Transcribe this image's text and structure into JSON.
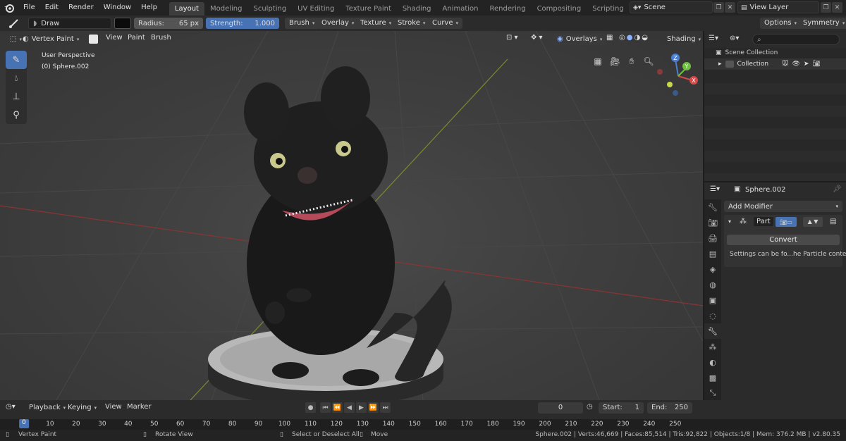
{
  "menu_bar": {
    "items": [
      "File",
      "Edit",
      "Render",
      "Window",
      "Help"
    ],
    "workspace_tabs": [
      "Layout",
      "Modeling",
      "Sculpting",
      "UV Editing",
      "Texture Paint",
      "Shading",
      "Animation",
      "Rendering",
      "Compositing",
      "Scripting"
    ],
    "active_tab": "Layout",
    "add_tab": "+",
    "scene": "Scene",
    "view_layer": "View Layer"
  },
  "tool_header": {
    "brush_name": "Draw",
    "radius_label": "Radius:",
    "radius_value": "65 px",
    "strength_label": "Strength:",
    "strength_value": "1.000",
    "strength_fraction": 1.0,
    "menus": [
      "Brush",
      "Overlay",
      "Texture",
      "Stroke",
      "Curve"
    ],
    "options": "Options",
    "symmetry": "Symmetry"
  },
  "viewport": {
    "mode": "Vertex Paint",
    "menus": [
      "View",
      "Paint",
      "Brush"
    ],
    "overlays": "Overlays",
    "shading": "Shading",
    "perspective": "User Perspective",
    "object_name": "(0) Sphere.002",
    "gizmo_labels": {
      "z": "Z",
      "y": "Y",
      "x": "X"
    }
  },
  "outliner": {
    "search_placeholder": "",
    "scene_collection": "Scene Collection",
    "collection": "Collection"
  },
  "properties": {
    "object": "Sphere.002",
    "add_modifier": "Add Modifier",
    "modifier_name": "Part",
    "convert_button": "Convert",
    "settings_note": "Settings can be fo...he Particle context"
  },
  "timeline": {
    "menus": [
      "Playback",
      "Keying",
      "View",
      "Marker"
    ],
    "current_frame": "0",
    "start_label": "Start:",
    "start_value": "1",
    "end_label": "End:",
    "end_value": "250",
    "ticks": [
      "0",
      "10",
      "20",
      "30",
      "40",
      "50",
      "60",
      "70",
      "80",
      "90",
      "100",
      "110",
      "120",
      "130",
      "140",
      "150",
      "160",
      "170",
      "180",
      "190",
      "200",
      "210",
      "220",
      "230",
      "240",
      "250"
    ]
  },
  "status_bar": {
    "mode": "Vertex Paint",
    "rotate": "Rotate View",
    "select": "Select or Deselect All",
    "move": "Move",
    "stats": "Sphere.002 | Verts:46,669 | Faces:85,514 | Tris:92,822 | Objects:1/8 | Mem: 376.2 MB | v2.80.35"
  },
  "colors": {
    "accent": "#4772b3",
    "header_bg": "#232323",
    "panel_bg": "#2b2b2b",
    "viewport_bg": "#3f3f3f"
  }
}
